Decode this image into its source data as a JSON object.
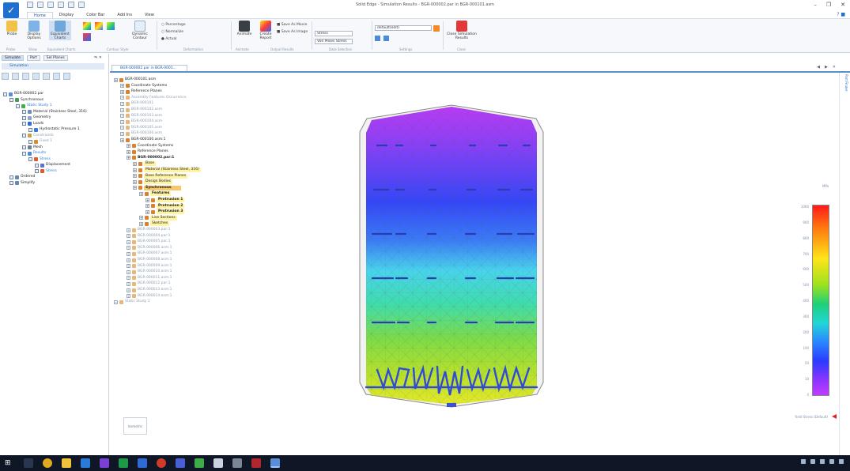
{
  "window": {
    "title": "Solid Edge - Simulation Results - BGR-000002.par in BGR-000101.asm"
  },
  "ribbon": {
    "tabs": [
      "Home",
      "Display",
      "Color Bar",
      "Add Ins",
      "View"
    ],
    "active_tab": "Home",
    "buttons": {
      "probe": "Probe",
      "display_options": "Display Options",
      "equivalent_charts": "Equivalent Charts",
      "dynamic_contour": "Dynamic Contour",
      "animate": "Animate",
      "create_report": "Create Report",
      "save_as_movie": "Save As Movie",
      "save_as_image": "Save As Image",
      "close_results": "Close Simulation Results"
    },
    "radios": [
      "Percentage",
      "Normalize",
      "Actual"
    ],
    "combos": {
      "result_type": "Stress",
      "component": "Von Mises Stress",
      "setting": "default(edit)"
    },
    "groups": [
      "Probe",
      "Show",
      "Equivalent Charts",
      "Contour Style",
      "Deformation",
      "Animate",
      "Output Results",
      "Data Selection",
      "Settings",
      "Close"
    ]
  },
  "left_panel": {
    "tabs": [
      "Simulate",
      "Part",
      "Sel Planes"
    ],
    "header": "Simulation",
    "tree": [
      {
        "label": "BGR-000002.par",
        "indent": 0,
        "dim": false,
        "icon": "part"
      },
      {
        "label": "Synchronous",
        "indent": 1,
        "dim": false,
        "icon": "sync"
      },
      {
        "label": "Static Study 1",
        "indent": 2,
        "dim": false,
        "icon": "study",
        "highlight": true
      },
      {
        "label": "Material (Stainless Steel, 316)",
        "indent": 3,
        "dim": false,
        "icon": "material"
      },
      {
        "label": "Geometry",
        "indent": 3,
        "dim": false,
        "icon": "geometry"
      },
      {
        "label": "Loads",
        "indent": 3,
        "dim": false,
        "icon": "loads"
      },
      {
        "label": "Hydrostatic Pressure 1",
        "indent": 4,
        "dim": false,
        "icon": "pressure"
      },
      {
        "label": "Constraints",
        "indent": 3,
        "dim": true,
        "icon": "constraint"
      },
      {
        "label": "Fixed 1",
        "indent": 4,
        "dim": true,
        "icon": "fixed"
      },
      {
        "label": "Mesh",
        "indent": 3,
        "dim": false,
        "icon": "mesh"
      },
      {
        "label": "Results",
        "indent": 3,
        "dim": false,
        "icon": "results",
        "highlight": true
      },
      {
        "label": "Stress",
        "indent": 4,
        "dim": false,
        "icon": "stress",
        "highlight": true
      },
      {
        "label": "Displacement",
        "indent": 5,
        "dim": false,
        "icon": "displacement"
      },
      {
        "label": "Stress",
        "indent": 5,
        "dim": false,
        "icon": "stress",
        "highlight": true
      },
      {
        "label": "Ordered",
        "indent": 1,
        "dim": false,
        "icon": "ordered"
      },
      {
        "label": "Simplify",
        "indent": 1,
        "dim": false,
        "icon": "simplify"
      }
    ]
  },
  "document_tab": {
    "label": "BGR-000002.par in BGR-0001..."
  },
  "assembly_tree": [
    {
      "label": "BGR-000101.asm",
      "indent": 0,
      "dim": false,
      "bold": false
    },
    {
      "label": "Coordinate Systems",
      "indent": 1,
      "dim": false,
      "bold": false
    },
    {
      "label": "Reference Planes",
      "indent": 1,
      "dim": false,
      "bold": false
    },
    {
      "label": "Assembly Features Occurrence",
      "indent": 1,
      "dim": true,
      "bold": false
    },
    {
      "label": "BGR-000101",
      "indent": 1,
      "dim": true,
      "bold": false
    },
    {
      "label": "BGR-000102.asm",
      "indent": 1,
      "dim": true,
      "bold": false
    },
    {
      "label": "BGR-000103.asm",
      "indent": 1,
      "dim": true,
      "bold": false
    },
    {
      "label": "BGR-000104.asm",
      "indent": 1,
      "dim": true,
      "bold": false
    },
    {
      "label": "BGR-000105.asm",
      "indent": 1,
      "dim": true,
      "bold": false
    },
    {
      "label": "BGR-000106.asm",
      "indent": 1,
      "dim": true,
      "bold": false
    },
    {
      "label": "BGR-000100.asm:1",
      "indent": 1,
      "dim": false,
      "bold": false
    },
    {
      "label": "Coordinate Systems",
      "indent": 2,
      "dim": false,
      "bold": false
    },
    {
      "label": "Reference Planes",
      "indent": 2,
      "dim": false,
      "bold": false
    },
    {
      "label": "BGR-000002.par:1",
      "indent": 2,
      "dim": false,
      "bold": true
    },
    {
      "label": "Base",
      "indent": 3,
      "dim": false,
      "bold": false,
      "yellow": true
    },
    {
      "label": "Material (Stainless Steel, 316)",
      "indent": 3,
      "dim": false,
      "bold": false,
      "yellow": true
    },
    {
      "label": "Base Reference Planes",
      "indent": 3,
      "dim": false,
      "bold": false,
      "yellow": true
    },
    {
      "label": "Design Bodies",
      "indent": 3,
      "dim": false,
      "bold": false,
      "yellow": true
    },
    {
      "label": "Synchronous",
      "indent": 3,
      "dim": false,
      "bold": true,
      "selected": true
    },
    {
      "label": "Features",
      "indent": 4,
      "dim": false,
      "bold": true,
      "yellow": true
    },
    {
      "label": "Protrusion 1",
      "indent": 5,
      "dim": false,
      "bold": true,
      "yellow": true
    },
    {
      "label": "Protrusion 2",
      "indent": 5,
      "dim": false,
      "bold": true,
      "yellow": true
    },
    {
      "label": "Protrusion 3",
      "indent": 5,
      "dim": false,
      "bold": true,
      "yellow": true
    },
    {
      "label": "Live Sections",
      "indent": 4,
      "dim": false,
      "bold": false,
      "yellow": true
    },
    {
      "label": "Sketches",
      "indent": 4,
      "dim": false,
      "bold": false,
      "yellow": true
    },
    {
      "label": "BGR-000003.par:1",
      "indent": 2,
      "dim": true,
      "bold": false
    },
    {
      "label": "BGR-000004.par:1",
      "indent": 2,
      "dim": true,
      "bold": false
    },
    {
      "label": "BGR-000005.par:1",
      "indent": 2,
      "dim": true,
      "bold": false
    },
    {
      "label": "BGR-000006.asm:1",
      "indent": 2,
      "dim": true,
      "bold": false
    },
    {
      "label": "BGR-000007.asm:1",
      "indent": 2,
      "dim": true,
      "bold": false
    },
    {
      "label": "BGR-000008.asm:1",
      "indent": 2,
      "dim": true,
      "bold": false
    },
    {
      "label": "BGR-000009.asm:1",
      "indent": 2,
      "dim": true,
      "bold": false
    },
    {
      "label": "BGR-000010.asm:1",
      "indent": 2,
      "dim": true,
      "bold": false
    },
    {
      "label": "BGR-000011.asm:1",
      "indent": 2,
      "dim": true,
      "bold": false
    },
    {
      "label": "BGR-000012.par:1",
      "indent": 2,
      "dim": true,
      "bold": false
    },
    {
      "label": "BGR-000013.asm:1",
      "indent": 2,
      "dim": true,
      "bold": false
    },
    {
      "label": "BGR-000014.asm:1",
      "indent": 2,
      "dim": true,
      "bold": false
    },
    {
      "label": "Static Study 1",
      "indent": 0,
      "dim": true,
      "bold": false
    }
  ],
  "legend": {
    "top_label": "MPa",
    "ticks": [
      "1000",
      "900",
      "800",
      "700",
      "600",
      "500",
      "400",
      "300",
      "200",
      "100",
      "50",
      "10",
      "0"
    ],
    "footer": "Yield Stress (Default)"
  },
  "view_cube_label": "Isometric",
  "right_strip_label": "Part Finder",
  "colors": {
    "accent": "#1f6fd0",
    "legend_high": "#ff1a1a",
    "legend_low": "#c03cff",
    "taskbar": "#0f1726"
  }
}
